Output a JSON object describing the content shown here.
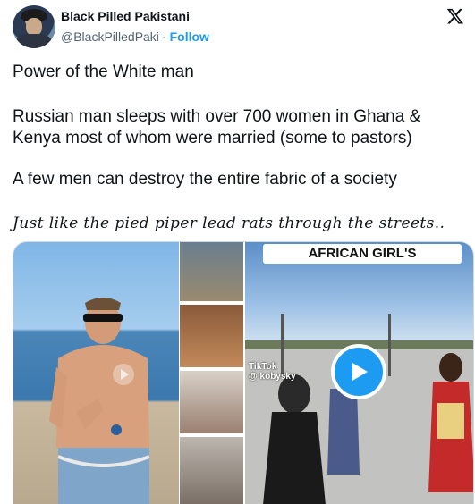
{
  "author": {
    "name": "Black Pilled Pakistani",
    "handle": "@BlackPilledPaki",
    "separator": "·",
    "follow_label": "Follow"
  },
  "tweet": {
    "line1": "Power of the White man",
    "line2": "Russian man sleeps with over 700 women in Ghana &",
    "line3": "Kenya most of whom were married (some to pastors)",
    "line4": "A few men can destroy the entire fabric of a society",
    "line5": "Just like the pied piper lead rats through the streets.."
  },
  "media": {
    "video_banner": "AFRICAN GIRL'S",
    "tiktok_label": "TikTok",
    "tiktok_user": "@ kobysky"
  },
  "icons": {
    "logo": "x-logo-icon",
    "play": "play-icon"
  },
  "colors": {
    "accent": "#1d9bf0",
    "text": "#0f1419",
    "secondary": "#536471"
  }
}
